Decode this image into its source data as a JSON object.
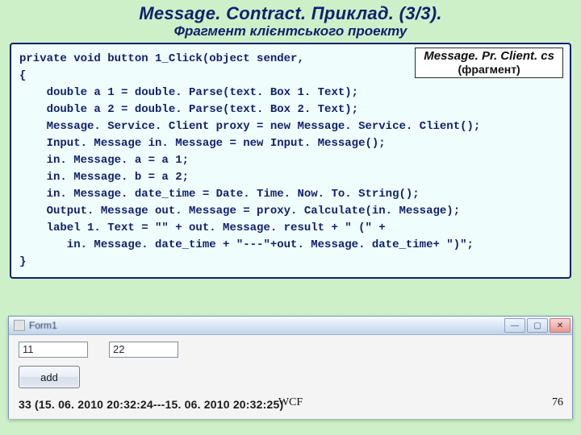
{
  "title": "Message. Contract.  Приклад.   (3/3).",
  "subtitle": "Фрагмент клієнтського проекту",
  "file_label": {
    "name": "Message. Pr. Client. cs",
    "fragment": "(фрагмент)"
  },
  "code": "private void button 1_Click(object sender,\n{\n    double a 1 = double. Parse(text. Box 1. Text);\n    double a 2 = double. Parse(text. Box 2. Text);\n    Message. Service. Client proxy = new Message. Service. Client();\n    Input. Message in. Message = new Input. Message();\n    in. Message. a = a 1;\n    in. Message. b = a 2;\n    in. Message. date_time = Date. Time. Now. To. String();\n    Output. Message out. Message = proxy. Calculate(in. Message);\n    label 1. Text = \"\" + out. Message. result + \" (\" +\n       in. Message. date_time + \"---\"+out. Message. date_time+ \")\";\n}",
  "form": {
    "caption": "Form1",
    "textbox1": "11",
    "textbox2": "22",
    "button": "add",
    "result": "33  (15. 06. 2010 20:32:24---15. 06. 2010 20:32:25)"
  },
  "footer_center": "WCF",
  "page": "76"
}
